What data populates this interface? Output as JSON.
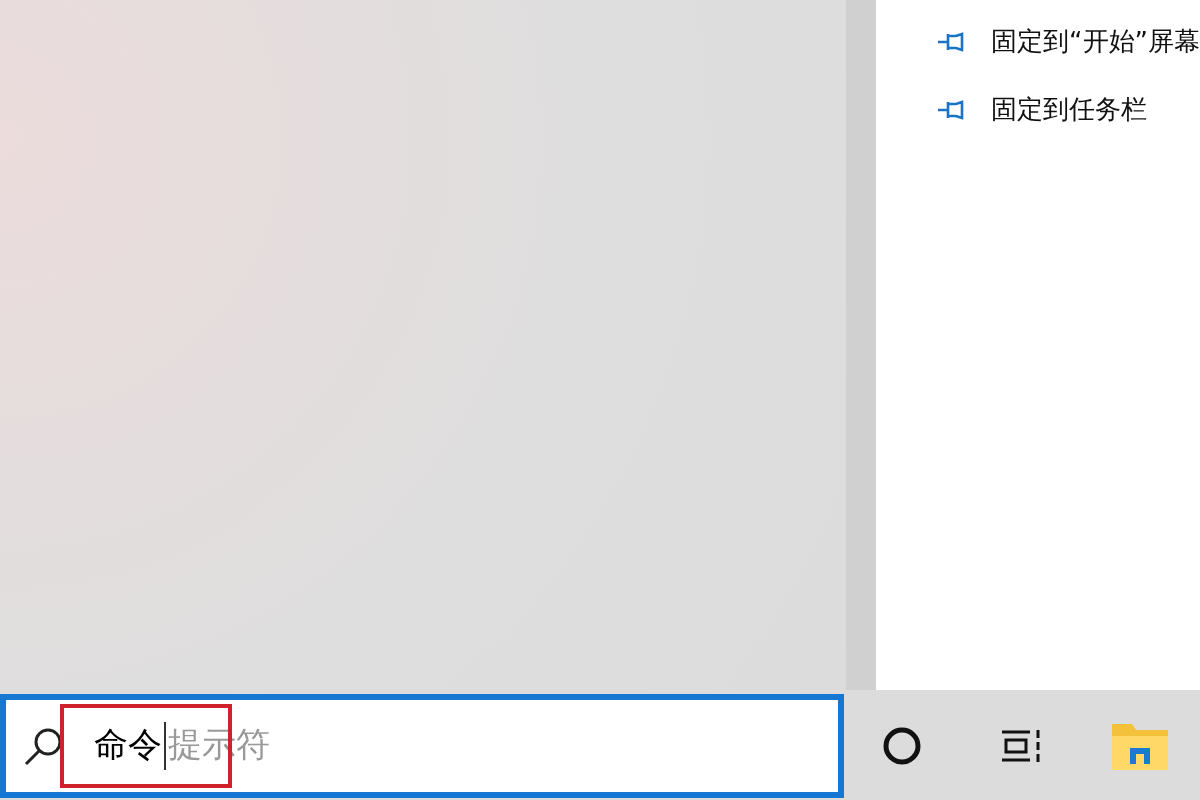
{
  "jump_list": [
    {
      "label": "固定到“开始”屏幕"
    },
    {
      "label": "固定到任务栏"
    }
  ],
  "search": {
    "value": "命令",
    "suggestion": "提示符",
    "value_highlighted": true
  },
  "taskbar_icons": [
    {
      "kind": "cortana"
    },
    {
      "kind": "task-view"
    },
    {
      "kind": "file-explorer"
    }
  ]
}
